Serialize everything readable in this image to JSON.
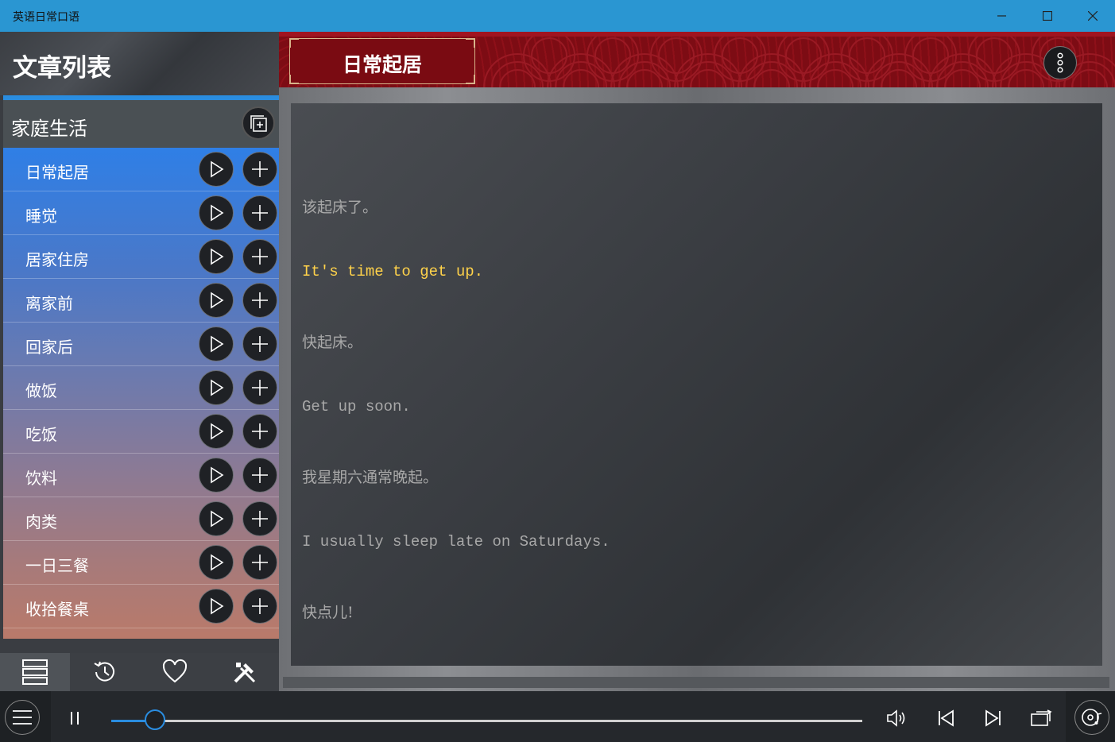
{
  "window": {
    "title": "英语日常口语"
  },
  "sidebar": {
    "heading": "文章列表",
    "category": "家庭生活",
    "items": [
      {
        "label": "日常起居"
      },
      {
        "label": "睡觉"
      },
      {
        "label": "居家住房"
      },
      {
        "label": "离家前"
      },
      {
        "label": "回家后"
      },
      {
        "label": "做饭"
      },
      {
        "label": "吃饭"
      },
      {
        "label": "饮料"
      },
      {
        "label": "肉类"
      },
      {
        "label": "一日三餐"
      },
      {
        "label": "收拾餐桌"
      }
    ],
    "tabs": [
      {
        "icon": "list-icon"
      },
      {
        "icon": "history-icon"
      },
      {
        "icon": "heart-icon"
      },
      {
        "icon": "tools-icon"
      }
    ]
  },
  "article": {
    "title": "日常起居",
    "lines": [
      {
        "text": "该起床了。",
        "active": false
      },
      {
        "text": "It's time to get up.",
        "active": true
      },
      {
        "text": "快起床。",
        "active": false
      },
      {
        "text": "Get up soon.",
        "active": false
      },
      {
        "text": "我星期六通常晚起。",
        "active": false
      },
      {
        "text": "I usually sleep late on Saturdays.",
        "active": false
      },
      {
        "text": "快点儿!",
        "active": false
      }
    ]
  },
  "player": {
    "progress": 0.058
  },
  "colors": {
    "accent": "#2a8de0",
    "highlight": "#ffd24a",
    "banner": "#7d0c14"
  }
}
